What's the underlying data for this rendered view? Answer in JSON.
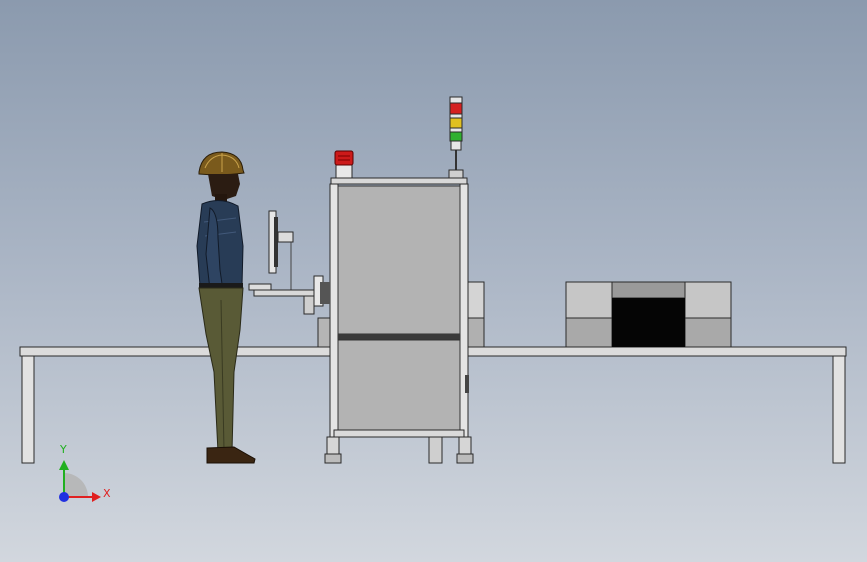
{
  "viewport": {
    "background_top": "#8b9aae",
    "background_bottom": "#d2d7de"
  },
  "scene": {
    "objects": [
      "worker-figure",
      "conveyor-table",
      "machine-cabinet",
      "beacon-light",
      "signal-tower",
      "monitor-arm",
      "output-enclosure"
    ],
    "signal_tower_colors": [
      "#d42020",
      "#e0c020",
      "#30b030"
    ],
    "beacon_color": "#cc1a1a"
  },
  "triad": {
    "x_label": "X",
    "y_label": "Y",
    "x_color": "#e02020",
    "y_color": "#20b020",
    "z_color": "#2030e0"
  }
}
